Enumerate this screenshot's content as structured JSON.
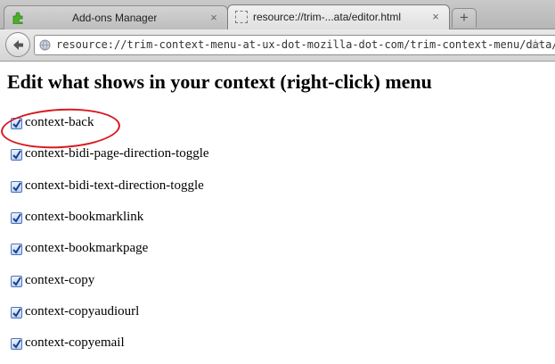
{
  "tabs": [
    {
      "title": "Add-ons Manager",
      "active": false,
      "icon": "puzzle-piece-icon"
    },
    {
      "title": "resource://trim-...ata/editor.html",
      "active": true,
      "icon": "blank-page-icon"
    }
  ],
  "newtab_label": "+",
  "tab_close_glyph": "×",
  "url": "resource://trim-context-menu-at-ux-dot-mozilla-dot-com/trim-context-menu/data/ed",
  "heading": "Edit what shows in your context (right-click) menu",
  "items": [
    {
      "label": "context-back",
      "checked": true
    },
    {
      "label": "context-bidi-page-direction-toggle",
      "checked": true
    },
    {
      "label": "context-bidi-text-direction-toggle",
      "checked": true
    },
    {
      "label": "context-bookmarklink",
      "checked": true
    },
    {
      "label": "context-bookmarkpage",
      "checked": true
    },
    {
      "label": "context-copy",
      "checked": true
    },
    {
      "label": "context-copyaudiourl",
      "checked": true
    },
    {
      "label": "context-copyemail",
      "checked": true
    }
  ],
  "colors": {
    "annotation": "#d9181f",
    "checkbox": "#4a74b8"
  }
}
